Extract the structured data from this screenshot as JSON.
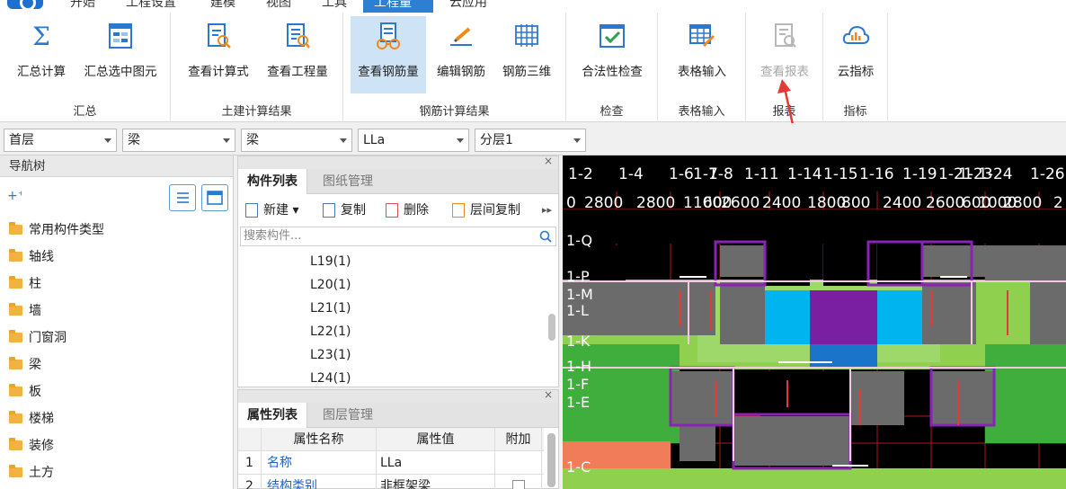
{
  "menu": {
    "tabs": [
      {
        "label": "开始",
        "active": false
      },
      {
        "label": "工程设置",
        "active": false
      },
      {
        "label": "建模",
        "active": false
      },
      {
        "label": "视图",
        "active": false
      },
      {
        "label": "工具",
        "active": false
      },
      {
        "label": "工程量",
        "active": true
      },
      {
        "label": "云应用",
        "active": false
      }
    ]
  },
  "ribbon": {
    "groups": [
      {
        "label": "汇总",
        "buttons": [
          {
            "label": "汇总计算",
            "icon": "sigma-icon"
          },
          {
            "label": "汇总选中图元",
            "icon": "summary-selected-icon"
          }
        ]
      },
      {
        "label": "土建计算结果",
        "buttons": [
          {
            "label": "查看计算式",
            "icon": "view-formula-icon"
          },
          {
            "label": "查看工程量",
            "icon": "view-quantity-icon"
          }
        ]
      },
      {
        "label": "钢筋计算结果",
        "buttons": [
          {
            "label": "查看钢筋量",
            "icon": "view-rebar-icon",
            "selected": true
          },
          {
            "label": "编辑钢筋",
            "icon": "edit-rebar-icon"
          },
          {
            "label": "钢筋三维",
            "icon": "rebar-3d-icon"
          }
        ]
      },
      {
        "label": "检查",
        "buttons": [
          {
            "label": "合法性检查",
            "icon": "check-icon"
          }
        ]
      },
      {
        "label": "表格输入",
        "buttons": [
          {
            "label": "表格输入",
            "icon": "table-input-icon"
          }
        ]
      },
      {
        "label": "报表",
        "buttons": [
          {
            "label": "查看报表",
            "icon": "report-icon",
            "disabled": true
          }
        ]
      },
      {
        "label": "指标",
        "buttons": [
          {
            "label": "云指标",
            "icon": "cloud-index-icon"
          }
        ]
      }
    ]
  },
  "selectors": [
    {
      "value": "首层"
    },
    {
      "value": "梁"
    },
    {
      "value": "梁"
    },
    {
      "value": "LLa"
    },
    {
      "value": "分层1"
    }
  ],
  "nav": {
    "title": "导航树",
    "items": [
      "常用构件类型",
      "轴线",
      "柱",
      "墙",
      "门窗洞",
      "梁",
      "板",
      "楼梯",
      "装修",
      "土方"
    ]
  },
  "components": {
    "tabs": [
      "构件列表",
      "图纸管理"
    ],
    "toolbar": {
      "new": "新建",
      "copy": "复制",
      "delete": "删除",
      "floor_copy": "层间复制"
    },
    "search_placeholder": "搜索构件...",
    "items": [
      "L19(1)",
      "L20(1)",
      "L21(1)",
      "L22(1)",
      "L23(1)",
      "L24(1)"
    ]
  },
  "properties": {
    "tabs": [
      "属性列表",
      "图层管理"
    ],
    "columns": [
      "属性名称",
      "属性值",
      "附加"
    ],
    "rows": [
      {
        "num": "1",
        "name": "名称",
        "value": "LLa"
      },
      {
        "num": "2",
        "name": "结构类别",
        "value": "非框架梁"
      }
    ]
  },
  "canvas": {
    "axis_labels": [
      "1-2",
      "1-4",
      "1-6",
      "1-7",
      "1-8",
      "1-11",
      "1-14",
      "1-15",
      "1-16",
      "1-19",
      "1-21",
      "1-23",
      "1-24",
      "1-26"
    ],
    "dimension_labels": [
      "0",
      "2800",
      "2800",
      "1100",
      "600",
      "2600",
      "2400",
      "1800",
      "800",
      "2400",
      "2600",
      "600",
      "1000",
      "2800",
      "2"
    ],
    "row_labels": [
      "1-Q",
      "1-P",
      "1-M",
      "1-L",
      "1-K",
      "1-H",
      "1-F",
      "1-E",
      "1-C"
    ]
  },
  "colors": {
    "ribbon_accent": "#2d7fd3",
    "selected_button": "#cfe3f7",
    "canvas_bg": "#000000",
    "slab_green": "#8fd14f",
    "wall_gray": "#6b6b6b",
    "column_purple": "#7a1fa2",
    "cyan_area": "#00b4ef",
    "annotation_red": "#e53935"
  }
}
